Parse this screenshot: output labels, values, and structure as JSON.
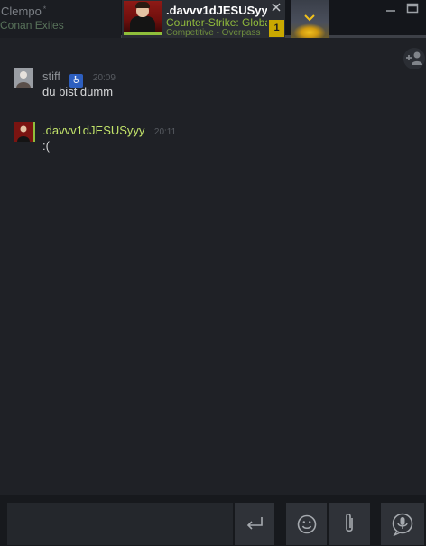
{
  "tabs": [
    {
      "name": "Clempo",
      "status_mark": "*",
      "game": "Conan Exiles",
      "active": false
    },
    {
      "name": ".davvv1dJESUSyyy",
      "game": "Counter-Strike: Global Offensive",
      "detail": "Competitive - Overpass",
      "unread": "1",
      "active": true
    }
  ],
  "messages": [
    {
      "sender": "stiff",
      "time": "20:09",
      "text": "du bist dumm",
      "badge_icon": "wheelchair-icon"
    },
    {
      "sender": ".davvv1dJESUSyyy",
      "time": "20:11",
      "text": ":("
    }
  ],
  "composer": {
    "placeholder": "",
    "icons": [
      "send-enter-icon",
      "emoji-icon",
      "paperclip-icon",
      "voice-icon"
    ]
  },
  "colors": {
    "accent_ingame": "#90ba3c",
    "unread_badge": "#c9a800",
    "background": "#1f2126"
  }
}
